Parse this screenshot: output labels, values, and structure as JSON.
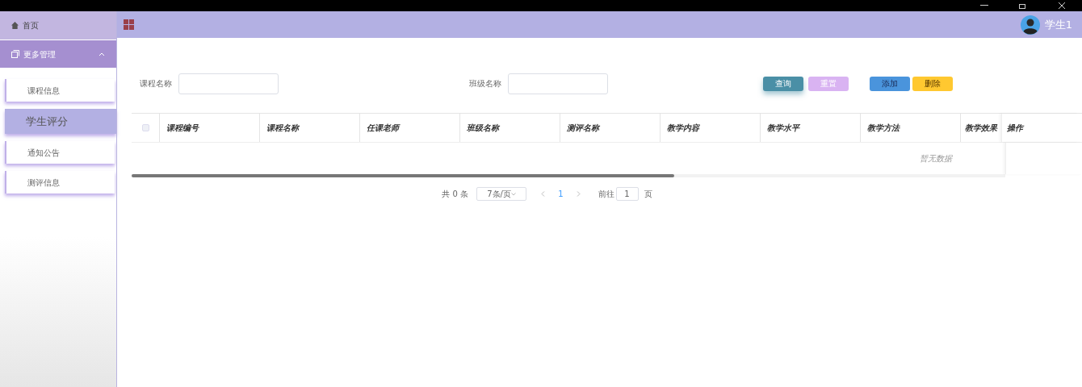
{
  "sidebar": {
    "home": {
      "label": "首页"
    },
    "group": {
      "label": "更多管理",
      "expanded": true,
      "items": [
        {
          "label": "课程信息",
          "selected": false
        },
        {
          "label": "学生评分",
          "selected": true
        },
        {
          "label": "通知公告",
          "selected": false
        },
        {
          "label": "测评信息",
          "selected": false
        }
      ]
    }
  },
  "header": {
    "user": "学生1"
  },
  "filters": [
    {
      "label": "课程名称"
    },
    {
      "label": "班级名称"
    }
  ],
  "buttons": [
    {
      "label": "查询",
      "kind": "query"
    },
    {
      "label": "重置",
      "kind": "reset"
    },
    {
      "label": "添加",
      "kind": "add"
    },
    {
      "label": "删除",
      "kind": "delete"
    }
  ],
  "table": {
    "columns": [
      "课程编号",
      "课程名称",
      "任课老师",
      "班级名称",
      "测评名称",
      "教学内容",
      "教学水平",
      "教学方法",
      "教学效果"
    ],
    "fixed_column": "操作",
    "empty_text": "暂无数据",
    "all_checked": false
  },
  "pagination": {
    "total": "共 0 条",
    "page_size": "7条/页",
    "pages": [
      {
        "label": "1",
        "selected": true
      }
    ],
    "jump_label": "前往",
    "jump_value": "1",
    "jump_suffix": "页"
  }
}
